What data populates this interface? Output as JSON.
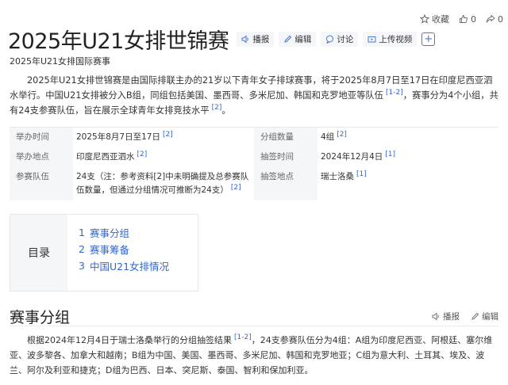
{
  "top_actions": {
    "favorite_label": "收藏",
    "like_count": "0",
    "share_count": "0"
  },
  "title": "2025年U21女排世锦赛",
  "tools": {
    "audio": "播报",
    "edit": "编辑",
    "discuss": "讨论",
    "upload": "上传视频"
  },
  "subtitle": "2025年U21女排国际赛事",
  "intro": {
    "part1": "2025年U21女排世锦赛是由国际排联主办的21岁以下青年女子排球赛事，将于2025年8月7日至17日在印度尼西亚泗水举行。中国U21女排被分入B组，同组包括美国、墨西哥、多米尼加、韩国和克罗地亚等队伍",
    "ref1": "[1-2]",
    "part2": "，赛事分为4个小组，共有24支参赛队伍，旨在展示全球青年女排竞技水平",
    "ref2": "[2]",
    "part3": "。"
  },
  "infobox": {
    "rows": [
      {
        "left_key": "举办时间",
        "left_val": "2025年8月7日至17日",
        "left_ref": "[2]",
        "right_key": "分组数量",
        "right_val": "4组",
        "right_ref": "[2]"
      },
      {
        "left_key": "举办地点",
        "left_val": "印度尼西亚泗水",
        "left_ref": "[2]",
        "right_key": "抽签时间",
        "right_val": "2024年12月4日",
        "right_ref": "[1]"
      },
      {
        "left_key": "参赛队伍",
        "left_val": "24支（注：参考资料[2]中未明确提及总参赛队伍数量，但通过分组情况可推断为24支）",
        "left_ref": "[2]",
        "right_key": "抽签地点",
        "right_val": "瑞士洛桑",
        "right_ref": "[1]"
      }
    ]
  },
  "toc": {
    "label": "目录",
    "items": [
      {
        "num": "1",
        "label": "赛事分组"
      },
      {
        "num": "2",
        "label": "赛事筹备"
      },
      {
        "num": "3",
        "label": "中国U21女排情况"
      }
    ]
  },
  "section": {
    "title": "赛事分组",
    "audio": "播报",
    "edit": "编辑",
    "body_part1": "根据2024年12月4日于瑞士洛桑举行的分组抽签结果",
    "body_ref": "[1-2]",
    "body_part2": "，24支参赛队伍分为4组：A组为印度尼西亚、阿根廷、塞尔维亚、波多黎各、加拿大和越南；B组为中国、美国、墨西哥、多米尼加、韩国和克罗地亚；C组为意大利、土耳其、埃及、波兰、阿尔及利亚和捷克；D组为巴西、日本、突尼斯、泰国、智利和保加利亚。"
  },
  "colors": {
    "link": "#3366cc",
    "accent_blue": "#4a78c8",
    "label_bg": "#f5f6f8"
  }
}
